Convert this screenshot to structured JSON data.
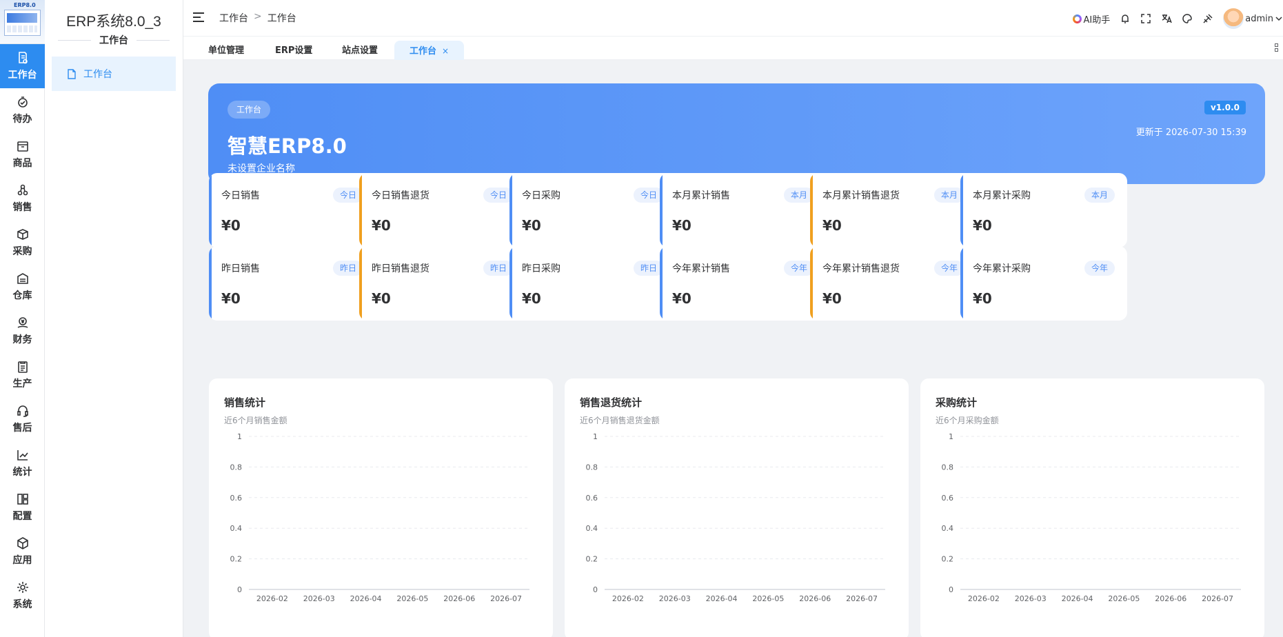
{
  "app": {
    "system_title": "ERP系统8.0_3",
    "logo_text": "ERP8.0"
  },
  "rail": {
    "items": [
      {
        "label": "工作台",
        "icon": "workbench-icon",
        "active": true
      },
      {
        "label": "待办",
        "icon": "todo-icon"
      },
      {
        "label": "商品",
        "icon": "goods-icon"
      },
      {
        "label": "销售",
        "icon": "sales-icon"
      },
      {
        "label": "采购",
        "icon": "purchase-icon"
      },
      {
        "label": "仓库",
        "icon": "warehouse-icon"
      },
      {
        "label": "财务",
        "icon": "finance-icon"
      },
      {
        "label": "生产",
        "icon": "production-icon"
      },
      {
        "label": "售后",
        "icon": "after-sales-icon"
      },
      {
        "label": "统计",
        "icon": "statistics-icon"
      },
      {
        "label": "配置",
        "icon": "config-icon"
      },
      {
        "label": "应用",
        "icon": "apps-icon"
      },
      {
        "label": "系统",
        "icon": "system-icon"
      }
    ]
  },
  "submenu": {
    "group_title": "工作台",
    "items": [
      {
        "label": "工作台",
        "icon": "document-icon",
        "active": true
      }
    ]
  },
  "header": {
    "breadcrumb": [
      "工作台",
      "工作台"
    ],
    "breadcrumb_sep": ">",
    "ai_label": "AI助手",
    "user": "admin"
  },
  "tabs": [
    {
      "label": "单位管理"
    },
    {
      "label": "ERP设置"
    },
    {
      "label": "站点设置"
    },
    {
      "label": "工作台",
      "active": true,
      "close": "×"
    }
  ],
  "hero": {
    "tag": "工作台",
    "title": "智慧ERP8.0",
    "subtitle": "未设置企业名称",
    "version": "v1.0.0",
    "updated": "更新于 2026-07-30 15:39"
  },
  "stats": [
    {
      "name": "今日销售",
      "tag": "今日",
      "value": "¥0",
      "color": "#4f8ef5"
    },
    {
      "name": "今日销售退货",
      "tag": "今日",
      "value": "¥0",
      "color": "#f0a020"
    },
    {
      "name": "今日采购",
      "tag": "今日",
      "value": "¥0",
      "color": "#4f8ef5"
    },
    {
      "name": "本月累计销售",
      "tag": "本月",
      "value": "¥0",
      "color": "#4f8ef5"
    },
    {
      "name": "本月累计销售退货",
      "tag": "本月",
      "value": "¥0",
      "color": "#f0a020"
    },
    {
      "name": "本月累计采购",
      "tag": "本月",
      "value": "¥0",
      "color": "#4f8ef5"
    },
    {
      "name": "昨日销售",
      "tag": "昨日",
      "value": "¥0",
      "color": "#4f8ef5"
    },
    {
      "name": "昨日销售退货",
      "tag": "昨日",
      "value": "¥0",
      "color": "#f0a020"
    },
    {
      "name": "昨日采购",
      "tag": "昨日",
      "value": "¥0",
      "color": "#4f8ef5"
    },
    {
      "name": "今年累计销售",
      "tag": "今年",
      "value": "¥0",
      "color": "#4f8ef5"
    },
    {
      "name": "今年累计销售退货",
      "tag": "今年",
      "value": "¥0",
      "color": "#f0a020"
    },
    {
      "name": "今年累计采购",
      "tag": "今年",
      "value": "¥0",
      "color": "#4f8ef5"
    }
  ],
  "charts": [
    {
      "title": "销售统计",
      "subtitle": "近6个月销售金额"
    },
    {
      "title": "销售退货统计",
      "subtitle": "近6个月销售退货金额"
    },
    {
      "title": "采购统计",
      "subtitle": "近6个月采购金额"
    }
  ],
  "chart_data": [
    {
      "type": "line",
      "title": "销售统计",
      "categories": [
        "2026-02",
        "2026-03",
        "2026-04",
        "2026-05",
        "2026-06",
        "2026-07"
      ],
      "y_ticks": [
        "0",
        "0.2",
        "0.4",
        "0.6",
        "0.8",
        "1"
      ],
      "ylim": [
        0,
        1
      ],
      "grid": true,
      "series": []
    },
    {
      "type": "line",
      "title": "销售退货统计",
      "categories": [
        "2026-02",
        "2026-03",
        "2026-04",
        "2026-05",
        "2026-06",
        "2026-07"
      ],
      "y_ticks": [
        "0",
        "0.2",
        "0.4",
        "0.6",
        "0.8",
        "1"
      ],
      "ylim": [
        0,
        1
      ],
      "grid": true,
      "series": []
    },
    {
      "type": "line",
      "title": "采购统计",
      "categories": [
        "2026-02",
        "2026-03",
        "2026-04",
        "2026-05",
        "2026-06",
        "2026-07"
      ],
      "y_ticks": [
        "0",
        "0.2",
        "0.4",
        "0.6",
        "0.8",
        "1"
      ],
      "ylim": [
        0,
        1
      ],
      "grid": true,
      "series": []
    }
  ]
}
